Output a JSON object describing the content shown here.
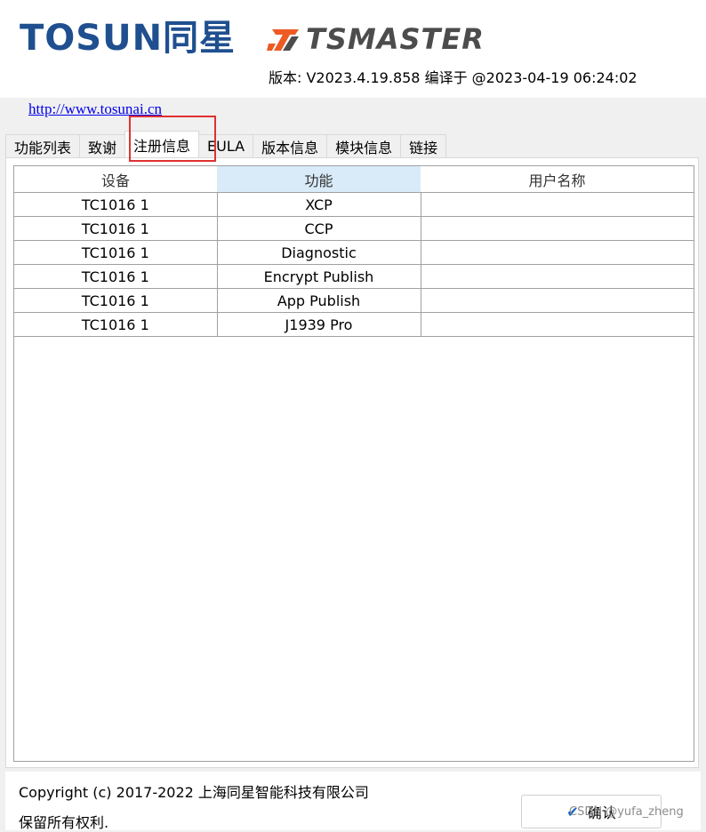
{
  "header": {
    "logo_tosun_text": "TOSUN",
    "logo_tosun_cn": "同星",
    "logo_tsmaster_text": "TSMASTER",
    "version": "版本: V2023.4.19.858 编译于 @2023-04-19 06:24:02"
  },
  "url": "http://www.tosunai.cn",
  "tabs": [
    {
      "label": "功能列表"
    },
    {
      "label": "致谢"
    },
    {
      "label": "注册信息"
    },
    {
      "label": "EULA"
    },
    {
      "label": "版本信息"
    },
    {
      "label": "模块信息"
    },
    {
      "label": "链接"
    }
  ],
  "table": {
    "columns": [
      "设备",
      "功能",
      "用户名称"
    ],
    "rows": [
      [
        "TC1016 1",
        "XCP",
        ""
      ],
      [
        "TC1016 1",
        "CCP",
        ""
      ],
      [
        "TC1016 1",
        "Diagnostic",
        ""
      ],
      [
        "TC1016 1",
        "Encrypt Publish",
        ""
      ],
      [
        "TC1016 1",
        "App Publish",
        ""
      ],
      [
        "TC1016 1",
        "J1939 Pro",
        ""
      ]
    ]
  },
  "footer": {
    "copyright": "Copyright (c) 2017-2022 上海同星智能科技有限公司",
    "rights": "保留所有权利.",
    "ok_label": "确认"
  },
  "watermark": "CSDN @yufa_zheng"
}
